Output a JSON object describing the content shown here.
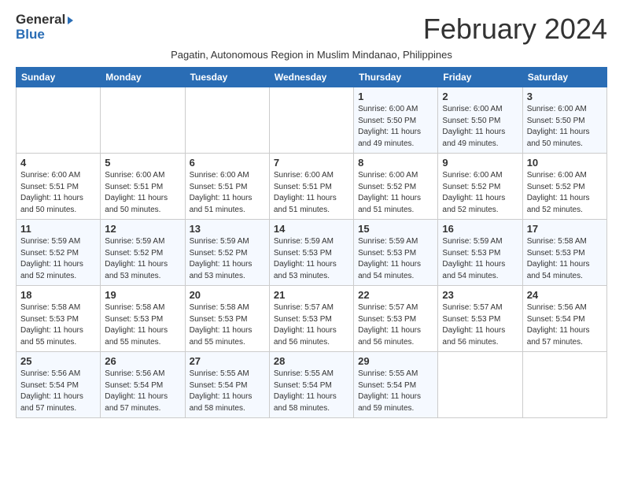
{
  "logo": {
    "line1": "General",
    "line2": "Blue"
  },
  "title": "February 2024",
  "subtitle": "Pagatin, Autonomous Region in Muslim Mindanao, Philippines",
  "weekdays": [
    "Sunday",
    "Monday",
    "Tuesday",
    "Wednesday",
    "Thursday",
    "Friday",
    "Saturday"
  ],
  "weeks": [
    [
      {
        "day": "",
        "info": ""
      },
      {
        "day": "",
        "info": ""
      },
      {
        "day": "",
        "info": ""
      },
      {
        "day": "",
        "info": ""
      },
      {
        "day": "1",
        "info": "Sunrise: 6:00 AM\nSunset: 5:50 PM\nDaylight: 11 hours\nand 49 minutes."
      },
      {
        "day": "2",
        "info": "Sunrise: 6:00 AM\nSunset: 5:50 PM\nDaylight: 11 hours\nand 49 minutes."
      },
      {
        "day": "3",
        "info": "Sunrise: 6:00 AM\nSunset: 5:50 PM\nDaylight: 11 hours\nand 50 minutes."
      }
    ],
    [
      {
        "day": "4",
        "info": "Sunrise: 6:00 AM\nSunset: 5:51 PM\nDaylight: 11 hours\nand 50 minutes."
      },
      {
        "day": "5",
        "info": "Sunrise: 6:00 AM\nSunset: 5:51 PM\nDaylight: 11 hours\nand 50 minutes."
      },
      {
        "day": "6",
        "info": "Sunrise: 6:00 AM\nSunset: 5:51 PM\nDaylight: 11 hours\nand 51 minutes."
      },
      {
        "day": "7",
        "info": "Sunrise: 6:00 AM\nSunset: 5:51 PM\nDaylight: 11 hours\nand 51 minutes."
      },
      {
        "day": "8",
        "info": "Sunrise: 6:00 AM\nSunset: 5:52 PM\nDaylight: 11 hours\nand 51 minutes."
      },
      {
        "day": "9",
        "info": "Sunrise: 6:00 AM\nSunset: 5:52 PM\nDaylight: 11 hours\nand 52 minutes."
      },
      {
        "day": "10",
        "info": "Sunrise: 6:00 AM\nSunset: 5:52 PM\nDaylight: 11 hours\nand 52 minutes."
      }
    ],
    [
      {
        "day": "11",
        "info": "Sunrise: 5:59 AM\nSunset: 5:52 PM\nDaylight: 11 hours\nand 52 minutes."
      },
      {
        "day": "12",
        "info": "Sunrise: 5:59 AM\nSunset: 5:52 PM\nDaylight: 11 hours\nand 53 minutes."
      },
      {
        "day": "13",
        "info": "Sunrise: 5:59 AM\nSunset: 5:52 PM\nDaylight: 11 hours\nand 53 minutes."
      },
      {
        "day": "14",
        "info": "Sunrise: 5:59 AM\nSunset: 5:53 PM\nDaylight: 11 hours\nand 53 minutes."
      },
      {
        "day": "15",
        "info": "Sunrise: 5:59 AM\nSunset: 5:53 PM\nDaylight: 11 hours\nand 54 minutes."
      },
      {
        "day": "16",
        "info": "Sunrise: 5:59 AM\nSunset: 5:53 PM\nDaylight: 11 hours\nand 54 minutes."
      },
      {
        "day": "17",
        "info": "Sunrise: 5:58 AM\nSunset: 5:53 PM\nDaylight: 11 hours\nand 54 minutes."
      }
    ],
    [
      {
        "day": "18",
        "info": "Sunrise: 5:58 AM\nSunset: 5:53 PM\nDaylight: 11 hours\nand 55 minutes."
      },
      {
        "day": "19",
        "info": "Sunrise: 5:58 AM\nSunset: 5:53 PM\nDaylight: 11 hours\nand 55 minutes."
      },
      {
        "day": "20",
        "info": "Sunrise: 5:58 AM\nSunset: 5:53 PM\nDaylight: 11 hours\nand 55 minutes."
      },
      {
        "day": "21",
        "info": "Sunrise: 5:57 AM\nSunset: 5:53 PM\nDaylight: 11 hours\nand 56 minutes."
      },
      {
        "day": "22",
        "info": "Sunrise: 5:57 AM\nSunset: 5:53 PM\nDaylight: 11 hours\nand 56 minutes."
      },
      {
        "day": "23",
        "info": "Sunrise: 5:57 AM\nSunset: 5:53 PM\nDaylight: 11 hours\nand 56 minutes."
      },
      {
        "day": "24",
        "info": "Sunrise: 5:56 AM\nSunset: 5:54 PM\nDaylight: 11 hours\nand 57 minutes."
      }
    ],
    [
      {
        "day": "25",
        "info": "Sunrise: 5:56 AM\nSunset: 5:54 PM\nDaylight: 11 hours\nand 57 minutes."
      },
      {
        "day": "26",
        "info": "Sunrise: 5:56 AM\nSunset: 5:54 PM\nDaylight: 11 hours\nand 57 minutes."
      },
      {
        "day": "27",
        "info": "Sunrise: 5:55 AM\nSunset: 5:54 PM\nDaylight: 11 hours\nand 58 minutes."
      },
      {
        "day": "28",
        "info": "Sunrise: 5:55 AM\nSunset: 5:54 PM\nDaylight: 11 hours\nand 58 minutes."
      },
      {
        "day": "29",
        "info": "Sunrise: 5:55 AM\nSunset: 5:54 PM\nDaylight: 11 hours\nand 59 minutes."
      },
      {
        "day": "",
        "info": ""
      },
      {
        "day": "",
        "info": ""
      }
    ]
  ]
}
